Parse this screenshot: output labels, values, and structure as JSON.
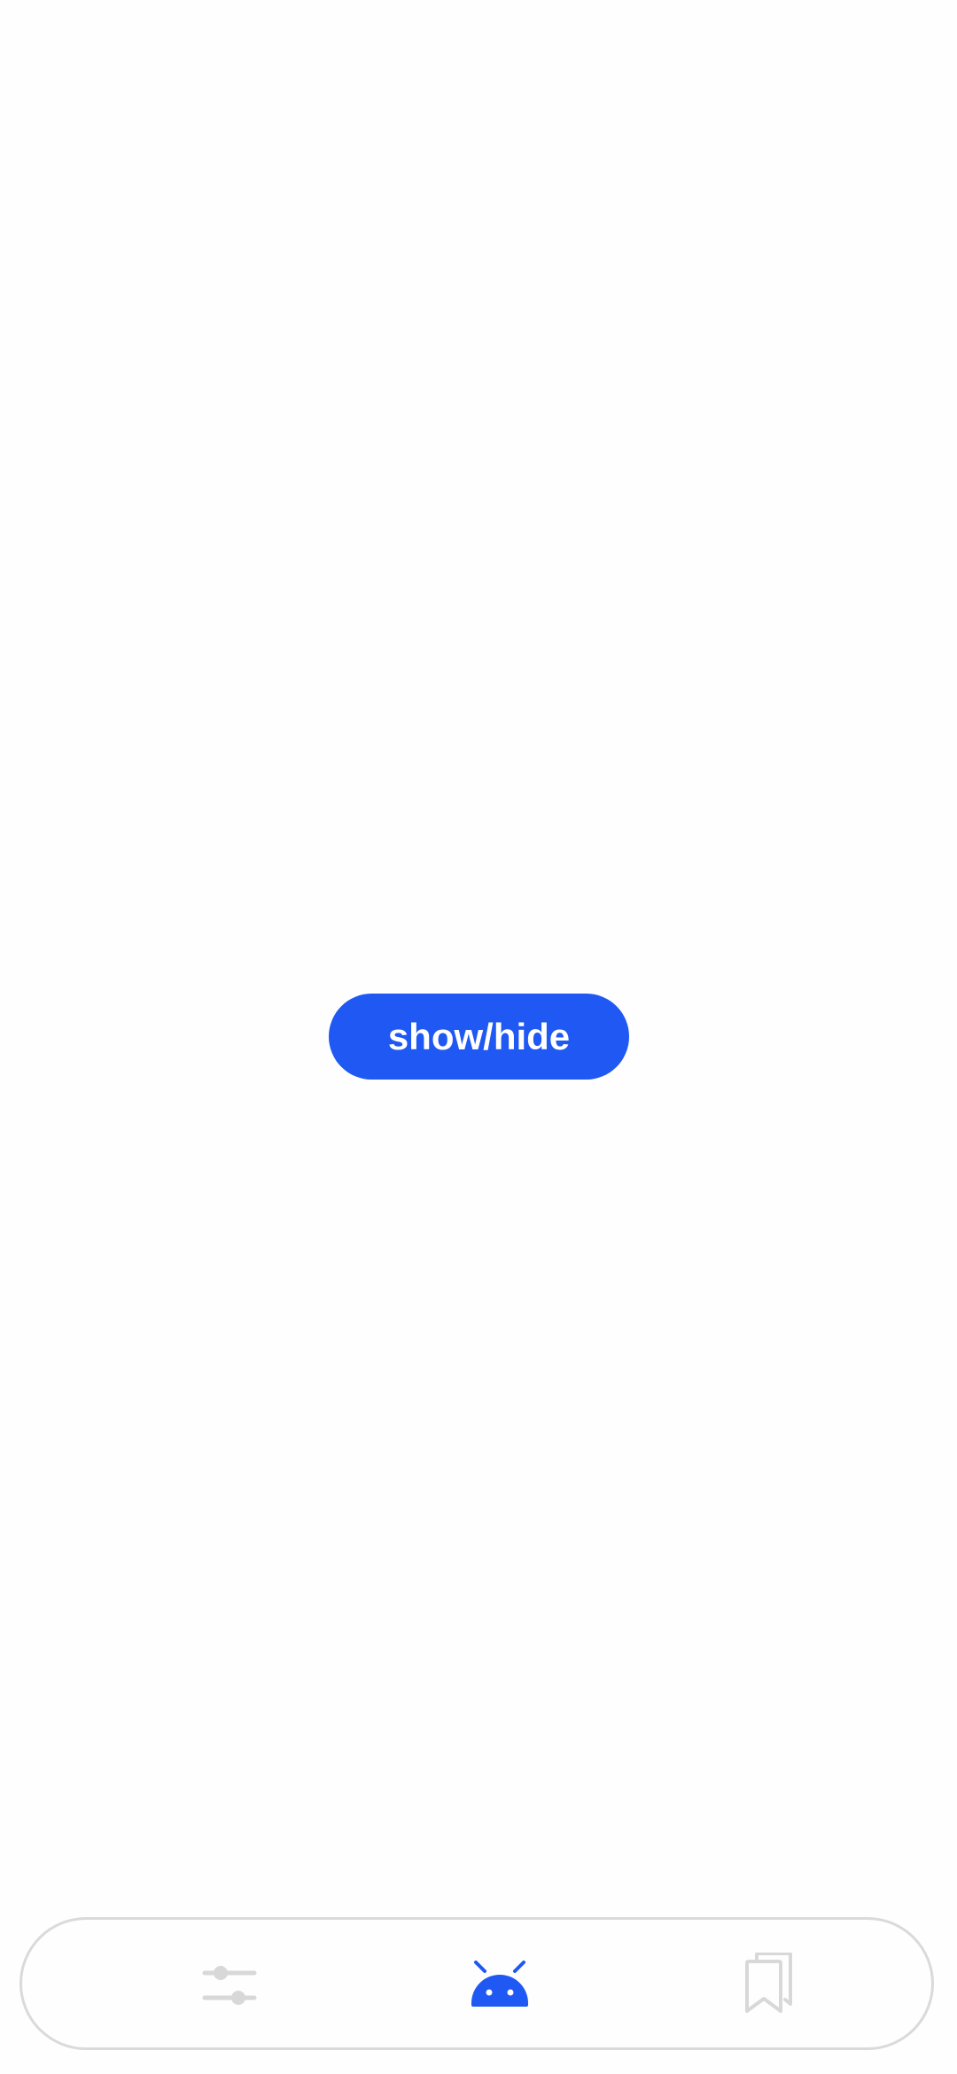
{
  "main": {
    "toggle_button_label": "show/hide"
  },
  "bottom_nav": {
    "items": [
      {
        "id": "settings",
        "icon": "sliders-icon",
        "active": false
      },
      {
        "id": "android",
        "icon": "android-icon",
        "active": true
      },
      {
        "id": "bookmarks",
        "icon": "bookmarks-icon",
        "active": false
      }
    ],
    "active_color": "#1F58F2",
    "inactive_color": "#D8D8D8"
  },
  "colors": {
    "accent": "#1F58F2",
    "background": "#FEFEFE",
    "nav_border": "#DADADA"
  }
}
